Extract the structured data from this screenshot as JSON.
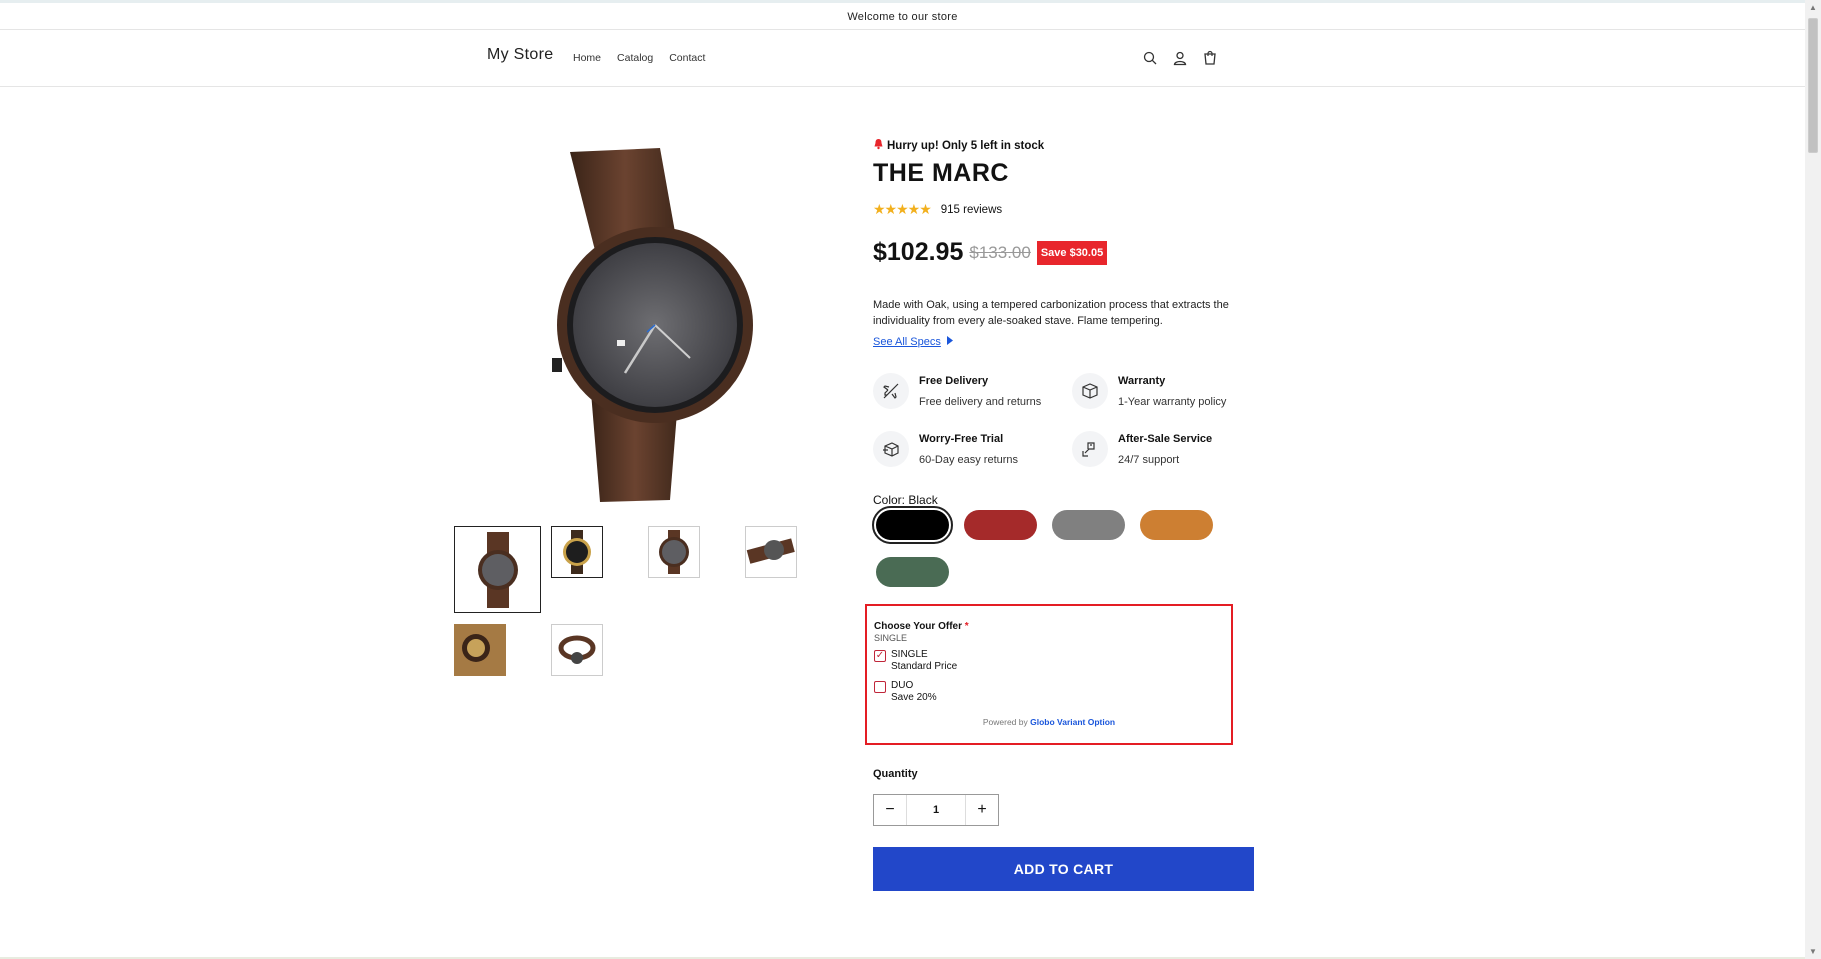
{
  "announcement": "Welcome to our store",
  "header": {
    "logo": "My Store",
    "nav": [
      "Home",
      "Catalog",
      "Contact"
    ],
    "icons": [
      "search-icon",
      "account-icon",
      "cart-icon"
    ]
  },
  "product": {
    "stock_notice": "Hurry up! Only 5 left in stock",
    "title": "THE MARC",
    "rating": 5,
    "reviews": "915 reviews",
    "price": "$102.95",
    "compare_price": "$133.00",
    "save_badge": "Save $30.05",
    "description": "Made with Oak, using a tempered carbonization process that extracts the individuality from every ale-soaked stave.  Flame tempering.",
    "specs_link": "See All Specs",
    "features": [
      {
        "title": "Free Delivery",
        "subtitle": "Free delivery and returns",
        "icon": "airplane-icon"
      },
      {
        "title": "Warranty",
        "subtitle": "1-Year warranty policy",
        "icon": "box-icon"
      },
      {
        "title": "Worry-Free Trial",
        "subtitle": "60-Day easy returns",
        "icon": "package-icon"
      },
      {
        "title": "After-Sale Service",
        "subtitle": "24/7 support",
        "icon": "support-icon"
      }
    ],
    "color_label": "Color: Black",
    "colors": [
      "#000000",
      "#a52a2a",
      "#808080",
      "#cd7f32",
      "#4a6b54"
    ],
    "offer": {
      "heading": "Choose Your Offer",
      "required_mark": "*",
      "selected_value": "SINGLE",
      "options": [
        {
          "name": "SINGLE",
          "desc": "Standard Price",
          "checked": true
        },
        {
          "name": "DUO",
          "desc": "Save 20%",
          "checked": false
        }
      ],
      "powered_prefix": "Powered by",
      "powered_brand": "Globo Variant Option"
    },
    "quantity_label": "Quantity",
    "quantity": "1",
    "add_to_cart": "ADD TO CART"
  },
  "colors": {
    "accent": "#2247c9",
    "sale": "#e8262c",
    "highlight_border": "#e41d24",
    "star": "#f2b01e"
  }
}
